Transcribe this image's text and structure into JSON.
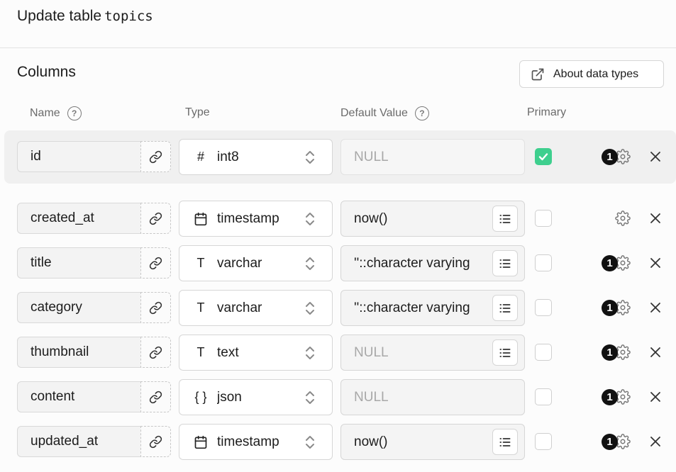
{
  "header": {
    "title_prefix": "Update table",
    "table_name": "topics"
  },
  "section": {
    "title": "Columns"
  },
  "about_button": {
    "label": "About data types"
  },
  "col_headers": {
    "name": "Name",
    "type": "Type",
    "default": "Default Value",
    "primary": "Primary",
    "help": "?"
  },
  "rows": [
    {
      "name": "id",
      "type_icon": "#",
      "type": "int8",
      "default": "NULL",
      "default_is_placeholder": true,
      "has_list_button": false,
      "primary": true,
      "badge": "1"
    },
    {
      "name": "created_at",
      "type_icon": "calendar",
      "type": "timestamp",
      "default": "now()",
      "default_is_placeholder": false,
      "has_list_button": true,
      "primary": false,
      "badge": ""
    },
    {
      "name": "title",
      "type_icon": "T",
      "type": "varchar",
      "default": "''::character varying",
      "default_is_placeholder": false,
      "has_list_button": true,
      "primary": false,
      "badge": "1"
    },
    {
      "name": "category",
      "type_icon": "T",
      "type": "varchar",
      "default": "''::character varying",
      "default_is_placeholder": false,
      "has_list_button": true,
      "primary": false,
      "badge": "1"
    },
    {
      "name": "thumbnail",
      "type_icon": "T",
      "type": "text",
      "default": "NULL",
      "default_is_placeholder": true,
      "has_list_button": true,
      "primary": false,
      "badge": "1"
    },
    {
      "name": "content",
      "type_icon": "{ }",
      "type": "json",
      "default": "NULL",
      "default_is_placeholder": true,
      "has_list_button": false,
      "primary": false,
      "badge": "1"
    },
    {
      "name": "updated_at",
      "type_icon": "calendar",
      "type": "timestamp",
      "default": "now()",
      "default_is_placeholder": false,
      "has_list_button": true,
      "primary": false,
      "badge": "1"
    }
  ],
  "colors": {
    "accent_green": "#3ecf8e",
    "badge_black": "#111111"
  },
  "icons": {
    "link": "link-icon",
    "chevron": "chevron-updown-icon",
    "list": "list-icon",
    "gear": "gear-icon",
    "close": "close-icon",
    "external": "external-link-icon",
    "calendar": "calendar-icon"
  }
}
